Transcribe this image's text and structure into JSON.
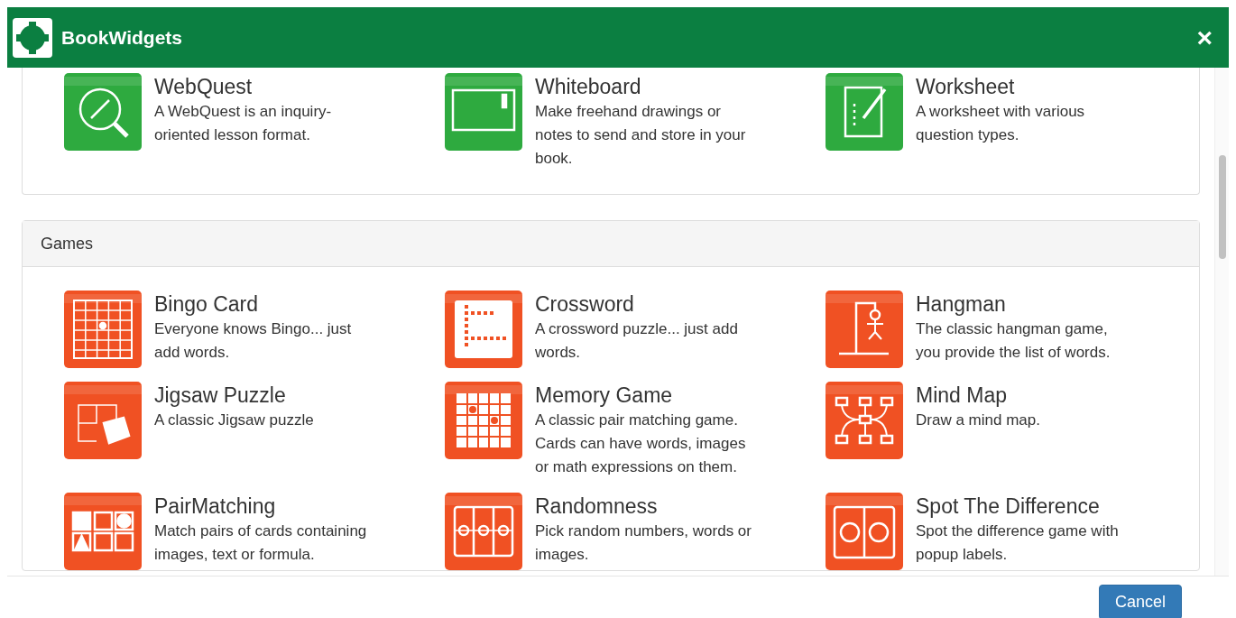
{
  "header": {
    "title": "BookWidgets",
    "close": "×"
  },
  "sections": [
    {
      "color": "#2eaa3f",
      "widgets": [
        {
          "kind": "compass",
          "title": "WebQuest",
          "lines": [
            "A WebQuest is an inquiry-",
            "oriented lesson format."
          ]
        },
        {
          "kind": "whiteboard",
          "title": "Whiteboard",
          "lines": [
            "Make freehand drawings or",
            "notes to send and store in your",
            "book."
          ]
        },
        {
          "kind": "worksheet",
          "title": "Worksheet",
          "lines": [
            "A worksheet with various",
            "question types."
          ]
        }
      ]
    },
    {
      "title": "Games",
      "color": "#f05123",
      "widgets": [
        {
          "kind": "bingo",
          "title": "Bingo Card",
          "lines": [
            "Everyone knows Bingo... just",
            "add words."
          ]
        },
        {
          "kind": "crossword",
          "title": "Crossword",
          "lines": [
            "A crossword puzzle... just add",
            "words."
          ]
        },
        {
          "kind": "hangman",
          "title": "Hangman",
          "lines": [
            "The classic hangman game,",
            "you provide the list of words."
          ]
        },
        {
          "kind": "jigsaw",
          "title": "Jigsaw Puzzle",
          "lines": [
            "A classic Jigsaw puzzle"
          ]
        },
        {
          "kind": "memory",
          "title": "Memory Game",
          "lines": [
            "A classic pair matching game.",
            "Cards can have words, images",
            "or math expressions on them."
          ]
        },
        {
          "kind": "mindmap",
          "title": "Mind Map",
          "lines": [
            "Draw a mind map."
          ]
        },
        {
          "kind": "pairs",
          "title": "PairMatching",
          "lines": [
            "Match pairs of cards containing",
            "images, text or formula."
          ]
        },
        {
          "kind": "randomness",
          "title": "Randomness",
          "lines": [
            "Pick random numbers, words or",
            "images."
          ]
        },
        {
          "kind": "spot",
          "title": "Spot The Difference",
          "lines": [
            "Spot the difference game with",
            "popup labels."
          ]
        }
      ]
    }
  ],
  "footer": {
    "button": "Cancel"
  }
}
